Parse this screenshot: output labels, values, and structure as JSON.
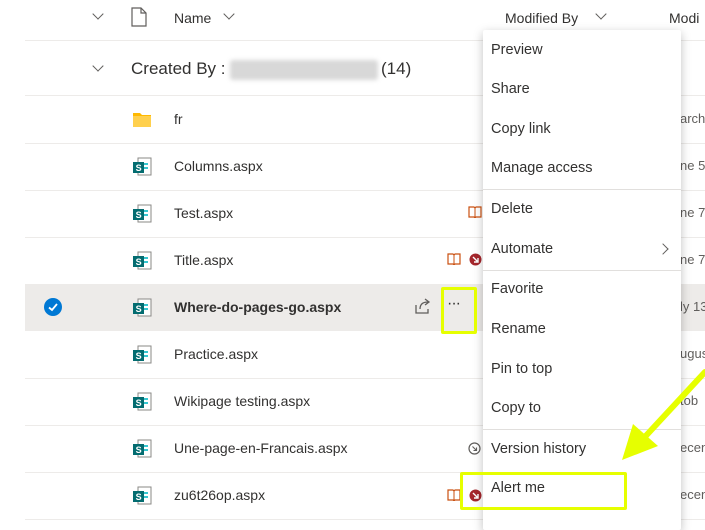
{
  "header": {
    "name_label": "Name",
    "modified_by_label": "Modified By",
    "modified_label": "Modi"
  },
  "group": {
    "label": "Created By :",
    "count": "(14)"
  },
  "rows": [
    {
      "name": "fr",
      "type": "folder",
      "modified": "arch"
    },
    {
      "name": "Columns.aspx",
      "type": "page",
      "modified": "ne 5"
    },
    {
      "name": "Test.aspx",
      "type": "page",
      "modified": "ne 7"
    },
    {
      "name": "Title.aspx",
      "type": "page",
      "modified": "ne 7"
    },
    {
      "name": "Where-do-pages-go.aspx",
      "type": "page",
      "modified": "ly 13",
      "selected": true
    },
    {
      "name": "Practice.aspx",
      "type": "page",
      "modified": "ugus"
    },
    {
      "name": "Wikipage testing.aspx",
      "type": "page",
      "modified": "tob"
    },
    {
      "name": "Une-page-en-Francais.aspx",
      "type": "page",
      "modified": "ecen"
    },
    {
      "name": "zu6t26op.aspx",
      "type": "page",
      "modified": "ecen"
    }
  ],
  "row_more_button": "···",
  "context_menu": {
    "items": [
      {
        "label": "Preview"
      },
      {
        "label": "Share"
      },
      {
        "label": "Copy link"
      },
      {
        "label": "Manage access"
      },
      {
        "label": "Delete"
      },
      {
        "label": "Automate",
        "submenu": true
      },
      {
        "label": "Favorite"
      },
      {
        "label": "Rename"
      },
      {
        "label": "Pin to top"
      },
      {
        "label": "Copy to"
      },
      {
        "label": "Version history"
      },
      {
        "label": "Alert me"
      }
    ]
  },
  "colors": {
    "accent": "#0078d4",
    "highlight": "#e6ff00",
    "sharepoint_icon": "#036c70",
    "folder": "#ffb900"
  }
}
